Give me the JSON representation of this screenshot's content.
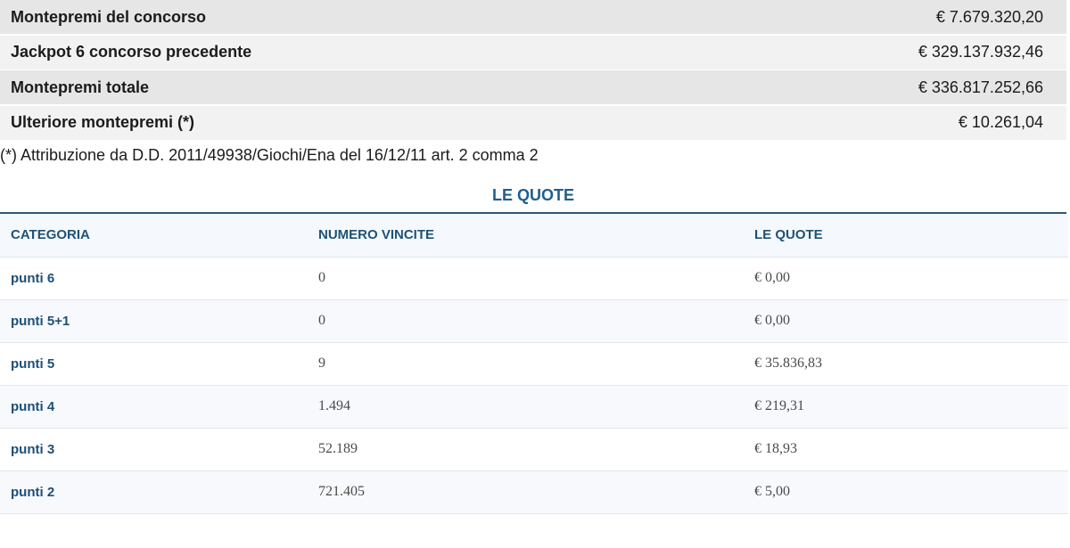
{
  "summary": [
    {
      "label": "Montepremi del concorso",
      "value": "€ 7.679.320,20"
    },
    {
      "label": "Jackpot 6 concorso precedente",
      "value": "€ 329.137.932,46"
    },
    {
      "label": "Montepremi totale",
      "value": "€ 336.817.252,66"
    },
    {
      "label": "Ulteriore montepremi (*)",
      "value": "€ 10.261,04"
    }
  ],
  "note": "(*) Attribuzione da D.D. 2011/49938/Giochi/Ena del 16/12/11 art. 2 comma 2",
  "quote_section": {
    "title": "LE QUOTE",
    "headers": {
      "categoria": "CATEGORIA",
      "numero_vincite": "NUMERO VINCITE",
      "le_quote": "LE QUOTE"
    },
    "rows": [
      {
        "categoria": "punti 6",
        "numero_vincite": "0",
        "quota": "€ 0,00"
      },
      {
        "categoria": "punti 5+1",
        "numero_vincite": "0",
        "quota": "€ 0,00"
      },
      {
        "categoria": "punti 5",
        "numero_vincite": "9",
        "quota": "€ 35.836,83"
      },
      {
        "categoria": "punti 4",
        "numero_vincite": "1.494",
        "quota": "€ 219,31"
      },
      {
        "categoria": "punti 3",
        "numero_vincite": "52.189",
        "quota": "€ 18,93"
      },
      {
        "categoria": "punti 2",
        "numero_vincite": "721.405",
        "quota": "€ 5,00"
      }
    ]
  }
}
